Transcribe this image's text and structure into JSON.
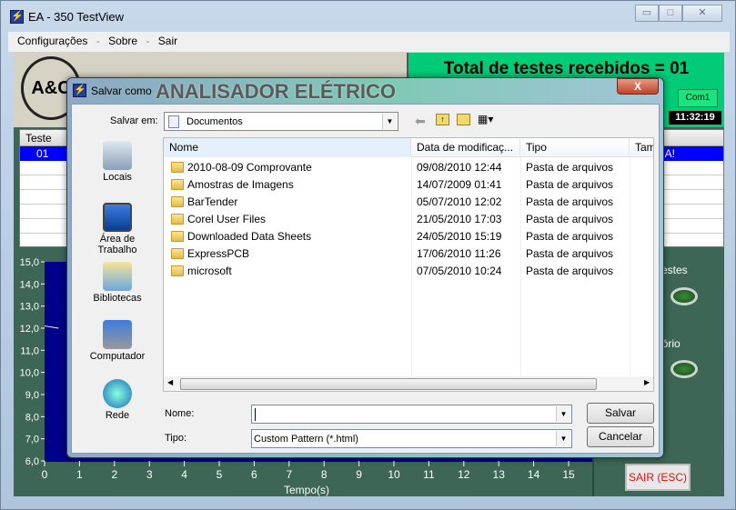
{
  "window": {
    "title": "EA - 350 TestView",
    "controls": [
      "minimize",
      "maximize",
      "close"
    ]
  },
  "menu": {
    "items": [
      "Configurações",
      "-",
      "Sobre",
      "-",
      "Sair"
    ]
  },
  "app": {
    "logo_text": "A&C",
    "header_text": "ANALISADOR ELÉTRICO",
    "total_label": "Total de testes recebidos = 01",
    "port": "Com1",
    "clock": "11:32:19",
    "table": {
      "header": "Teste",
      "rows": [
        {
          "id": "01",
          "status": "DA!"
        }
      ]
    },
    "right_panel": {
      "testes_label": "Testes",
      "relatorio_label": "latório",
      "sair_label": "SAIR (ESC)"
    },
    "colors": {
      "banner": "#00cc77",
      "plot": "#00008a",
      "background": "#3d6656",
      "selected_row": "#0000ff"
    }
  },
  "chart_data": {
    "type": "line",
    "xlabel": "Tempo(s)",
    "ylabel": "",
    "xlim": [
      0,
      15
    ],
    "ylim": [
      6,
      15
    ],
    "x_ticks": [
      "0",
      "1",
      "2",
      "3",
      "4",
      "5",
      "6",
      "7",
      "8",
      "9",
      "10",
      "11",
      "12",
      "13",
      "14",
      "15"
    ],
    "y_ticks": [
      "15,0",
      "14,0",
      "13,0",
      "12,0",
      "11,0",
      "10,0",
      "9,0",
      "8,0",
      "7,0",
      "6,0"
    ],
    "series": [
      {
        "points": [
          [
            0,
            12.1
          ],
          [
            0.4,
            12.0
          ]
        ]
      }
    ]
  },
  "dialog": {
    "title": "Salvar como",
    "save_in_label": "Salvar em:",
    "save_in_value": "Documentos",
    "places": [
      {
        "label": "Locais",
        "icon": "recent-places-icon"
      },
      {
        "label": "Área de Trabalho",
        "icon": "desktop-icon"
      },
      {
        "label": "Bibliotecas",
        "icon": "libraries-icon"
      },
      {
        "label": "Computador",
        "icon": "computer-icon"
      },
      {
        "label": "Rede",
        "icon": "network-icon"
      }
    ],
    "columns": [
      "Nome",
      "Data de modificaç...",
      "Tipo",
      "Tam"
    ],
    "files": [
      {
        "name": "2010-08-09 Comprovante",
        "date": "09/08/2010 12:44",
        "type": "Pasta de arquivos"
      },
      {
        "name": "Amostras de Imagens",
        "date": "14/07/2009 01:41",
        "type": "Pasta de arquivos"
      },
      {
        "name": "BarTender",
        "date": "05/07/2010 12:02",
        "type": "Pasta de arquivos"
      },
      {
        "name": "Corel User Files",
        "date": "21/05/2010 17:03",
        "type": "Pasta de arquivos"
      },
      {
        "name": "Downloaded Data Sheets",
        "date": "24/05/2010 15:19",
        "type": "Pasta de arquivos"
      },
      {
        "name": "ExpressPCB",
        "date": "17/06/2010 11:26",
        "type": "Pasta de arquivos"
      },
      {
        "name": "microsoft",
        "date": "07/05/2010 10:24",
        "type": "Pasta de arquivos"
      }
    ],
    "name_label": "Nome:",
    "name_value": "",
    "type_label": "Tipo:",
    "type_value": "Custom Pattern (*.html)",
    "save_button": "Salvar",
    "cancel_button": "Cancelar",
    "close_glyph": "X"
  }
}
